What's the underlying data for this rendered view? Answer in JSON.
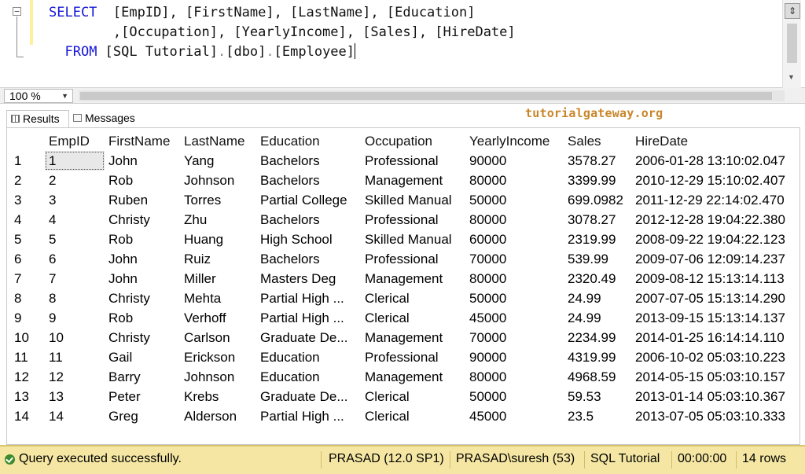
{
  "editor": {
    "collapse_glyph": "−",
    "line1": {
      "kw": "SELECT",
      "cols": "  [EmpID], [FirstName], [LastName], [Education]"
    },
    "line2": {
      "indent": "        ",
      "cols": ",[Occupation], [YearlyIncome], [Sales], [HireDate]"
    },
    "line3": {
      "kw": "FROM",
      "table": " [SQL Tutorial]",
      "dot1": ".",
      "schema": "[dbo]",
      "dot2": ".",
      "name": "[Employee]"
    }
  },
  "zoom": {
    "value": "100 %"
  },
  "tabs": {
    "results": "Results",
    "messages": "Messages"
  },
  "watermark": "tutorialgateway.org",
  "results": {
    "columns": [
      "",
      "EmpID",
      "FirstName",
      "LastName",
      "Education",
      "Occupation",
      "YearlyIncome",
      "Sales",
      "HireDate"
    ],
    "rows": [
      [
        "1",
        "1",
        "John",
        "Yang",
        "Bachelors",
        "Professional",
        "90000",
        "3578.27",
        "2006-01-28 13:10:02.047"
      ],
      [
        "2",
        "2",
        "Rob",
        "Johnson",
        "Bachelors",
        "Management",
        "80000",
        "3399.99",
        "2010-12-29 15:10:02.407"
      ],
      [
        "3",
        "3",
        "Ruben",
        "Torres",
        "Partial College",
        "Skilled Manual",
        "50000",
        "699.0982",
        "2011-12-29 22:14:02.470"
      ],
      [
        "4",
        "4",
        "Christy",
        "Zhu",
        "Bachelors",
        "Professional",
        "80000",
        "3078.27",
        "2012-12-28 19:04:22.380"
      ],
      [
        "5",
        "5",
        "Rob",
        "Huang",
        "High School",
        "Skilled Manual",
        "60000",
        "2319.99",
        "2008-09-22 19:04:22.123"
      ],
      [
        "6",
        "6",
        "John",
        "Ruiz",
        "Bachelors",
        "Professional",
        "70000",
        "539.99",
        "2009-07-06 12:09:14.237"
      ],
      [
        "7",
        "7",
        "John",
        "Miller",
        "Masters Deg",
        "Management",
        "80000",
        "2320.49",
        "2009-08-12 15:13:14.113"
      ],
      [
        "8",
        "8",
        "Christy",
        "Mehta",
        "Partial High ...",
        "Clerical",
        "50000",
        "24.99",
        "2007-07-05 15:13:14.290"
      ],
      [
        "9",
        "9",
        "Rob",
        "Verhoff",
        "Partial High ...",
        "Clerical",
        "45000",
        "24.99",
        "2013-09-15 15:13:14.137"
      ],
      [
        "10",
        "10",
        "Christy",
        "Carlson",
        "Graduate De...",
        "Management",
        "70000",
        "2234.99",
        "2014-01-25 16:14:14.110"
      ],
      [
        "11",
        "11",
        "Gail",
        "Erickson",
        "Education",
        "Professional",
        "90000",
        "4319.99",
        "2006-10-02 05:03:10.223"
      ],
      [
        "12",
        "12",
        "Barry",
        "Johnson",
        "Education",
        "Management",
        "80000",
        "4968.59",
        "2014-05-15 05:03:10.157"
      ],
      [
        "13",
        "13",
        "Peter",
        "Krebs",
        "Graduate De...",
        "Clerical",
        "50000",
        "59.53",
        "2013-01-14 05:03:10.367"
      ],
      [
        "14",
        "14",
        "Greg",
        "Alderson",
        "Partial High ...",
        "Clerical",
        "45000",
        "23.5",
        "2013-07-05 05:03:10.333"
      ]
    ]
  },
  "status": {
    "message": "Query executed successfully.",
    "server": "PRASAD (12.0 SP1)",
    "user": "PRASAD\\suresh (53)",
    "database": "SQL Tutorial",
    "elapsed": "00:00:00",
    "rows": "14 rows"
  },
  "colors": {
    "keyword": "#1515d8",
    "status_bar": "#f5e7a3",
    "watermark": "#c8862a",
    "gutter_marker": "#ffee9a"
  },
  "icons": [
    "collapse-toggle-icon",
    "split-editor-icon",
    "grid-results-icon",
    "messages-icon",
    "success-check-icon"
  ]
}
